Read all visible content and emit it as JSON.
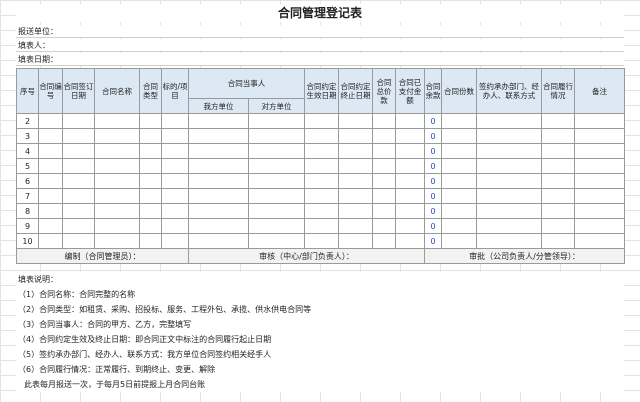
{
  "title": "合同管理登记表",
  "info": [
    "报送单位：",
    "填表人：",
    "填表日期："
  ],
  "headers": {
    "seq": "序号",
    "contract_no": "合同编号",
    "sign_date": "合同签订日期",
    "name": "合同名称",
    "type": "合同类型",
    "target": "标的/项目",
    "parties": "合同当事人",
    "our_party": "我方单位",
    "other_party": "对方单位",
    "effective_date": "合同约定生效日期",
    "end_date": "合同约定终止日期",
    "total": "合同总价款",
    "paid": "合同已支付金额",
    "balance": "合同余款",
    "copies": "合同份数",
    "dept": "签约承办部门、经办人、联系方式",
    "status": "合同履行情况",
    "remark": "备注"
  },
  "rows": [
    {
      "seq": "2",
      "balance": "0"
    },
    {
      "seq": "3",
      "balance": "0"
    },
    {
      "seq": "4",
      "balance": "0"
    },
    {
      "seq": "5",
      "balance": "0"
    },
    {
      "seq": "6",
      "balance": "0"
    },
    {
      "seq": "7",
      "balance": "0"
    },
    {
      "seq": "8",
      "balance": "0"
    },
    {
      "seq": "9",
      "balance": "0"
    },
    {
      "seq": "10",
      "balance": "0"
    }
  ],
  "footer": {
    "compile": "编制（合同管理员）：",
    "review": "审核（中心/部门负责人）：",
    "approve": "审批（公司负责人/分管领导）："
  },
  "notes": [
    "填表说明：",
    "（1）合同名称：合同完整的名称",
    "（2）合同类型：如租赁、采购、招投标、服务、工程外包、承揽、供水供电合同等",
    "（3）合同当事人：合同的甲方、乙方，完整填写",
    "（4）合同约定生效及终止日期：即合同正文中标注的合同履行起止日期",
    "（5）签约承办部门、经办人、联系方式：我方单位合同签约相关经手人",
    "（6）合同履行情况：正常履行、到期终止、变更、解除",
    "此表每月报送一次，于每月5日前提报上月合同台账"
  ]
}
